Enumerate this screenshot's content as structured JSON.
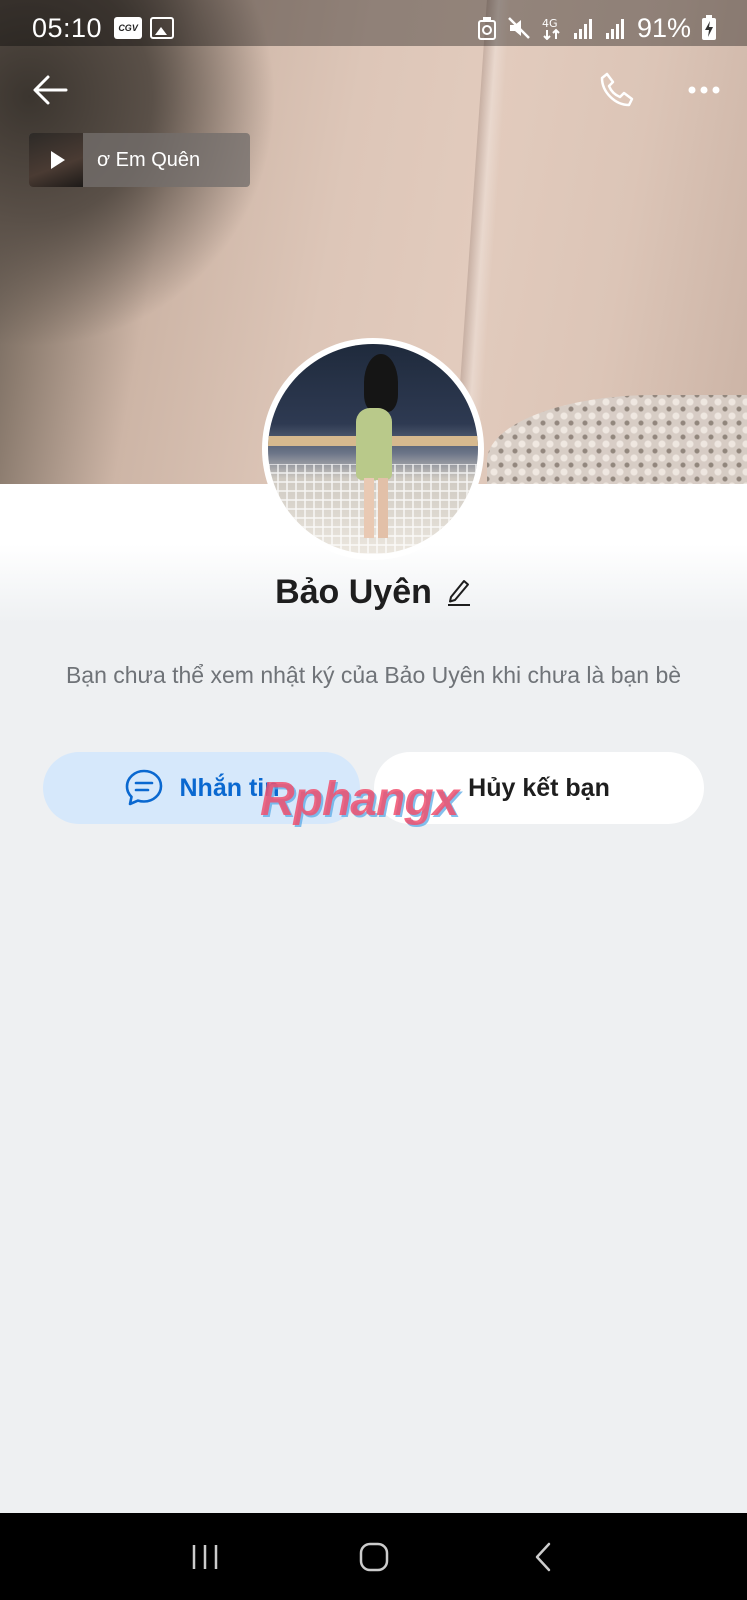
{
  "status_bar": {
    "time": "05:10",
    "badge_text": "CGV",
    "battery_percent": "91%"
  },
  "cover": {
    "music_title": "ơ Em Quên"
  },
  "profile": {
    "name": "Bảo Uyên",
    "notice": "Bạn chưa thể xem nhật ký của Bảo Uyên khi chưa là bạn bè"
  },
  "actions": {
    "message_label": "Nhắn tin",
    "unfriend_label": "Hủy kết bạn"
  },
  "watermark": "Rphangx",
  "colors": {
    "accent_blue": "#0a68d0",
    "message_button_bg": "#d6e8fb",
    "page_bg": "#eef0f2",
    "nav_bar_bg": "#000000"
  },
  "icons": {
    "top_left": "back-arrow-icon",
    "top_right": [
      "phone-icon",
      "more-icon"
    ],
    "message_button": "chat-bubble-icon",
    "name_edit": "pencil-icon",
    "navigation": [
      "recent-apps-icon",
      "home-icon",
      "back-icon"
    ]
  }
}
